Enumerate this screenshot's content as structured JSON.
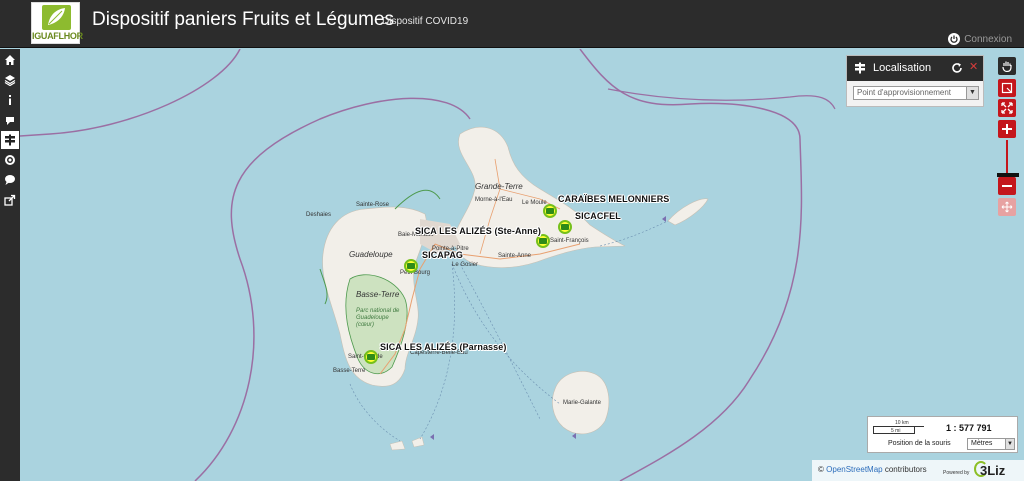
{
  "header": {
    "logo_text": "IGUAFLHOR",
    "title": "Dispositif paniers Fruits et Légumes",
    "subtitle": "Dispositif COVID19",
    "login_label": "Connexion"
  },
  "toolbar": {
    "items": [
      {
        "icon": "home-icon"
      },
      {
        "icon": "layers-icon"
      },
      {
        "icon": "info-icon"
      },
      {
        "icon": "comment-icon"
      },
      {
        "icon": "locate-signpost-icon"
      },
      {
        "icon": "target-icon"
      },
      {
        "icon": "chat-icon"
      },
      {
        "icon": "share-icon"
      }
    ]
  },
  "locate_panel": {
    "title": "Localisation",
    "select_value": "Point d'approvisionnement"
  },
  "map": {
    "markers": [
      {
        "label": "CARAÏBES MELONNIERS"
      },
      {
        "label": "SICACFEL"
      },
      {
        "label": "SICA LES ALIZÉS (Ste-Anne)"
      },
      {
        "label": "SICAPAG"
      },
      {
        "label": "SICA LES ALIZÉS (Parnasse)"
      }
    ],
    "places": {
      "grande_terre": "Grande-Terre",
      "morne": "Morne-à-l'Eau",
      "le_moule": "Le Moule",
      "saint_francois": "Saint-François",
      "sainte_anne": "Sainte-Anne",
      "le_gosier": "Le Gosier",
      "pointe_a_pitre": "Pointe-à-Pitre",
      "baie_mahault": "Baie-Mahault",
      "petit_bourg": "Petit-Bourg",
      "sainte_rose": "Sainte-Rose",
      "deshaies": "Deshaies",
      "guadeloupe": "Guadeloupe",
      "basse_terre_region": "Basse-Terre",
      "park": "Parc national de Guadeloupe (cœur)",
      "saint_claude": "Saint-Claude",
      "basse_terre_town": "Basse-Terre",
      "capesterre": "Capesterre-Belle-Eau",
      "marie_galante": "Marie-Galante"
    }
  },
  "scale": {
    "km_label": "10 km",
    "mi_label": "5 mi",
    "ratio": "1 : 577 791",
    "mouse_position_label": "Position de la souris",
    "units_value": "Mètres"
  },
  "attribution": {
    "prefix": "©",
    "osm_link": "OpenStreetMap",
    "suffix": "contributors",
    "powered_by": "Powered by",
    "brand": "3Liz"
  }
}
